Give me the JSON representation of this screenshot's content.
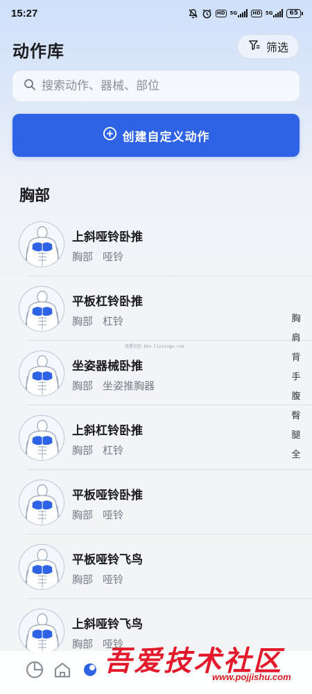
{
  "status_bar": {
    "time": "15:27",
    "network_label_1": "5G",
    "network_label_2": "5G",
    "hd_label": "HD",
    "battery": "65",
    "icons": [
      "mute-bell-icon",
      "alarm-icon",
      "hd-icon",
      "signal-icon",
      "signal-icon",
      "battery-icon"
    ]
  },
  "header": {
    "title": "动作库",
    "filter_label": "筛选"
  },
  "search": {
    "placeholder": "搜索动作、器械、部位"
  },
  "create_button": {
    "label": "创建自定义动作"
  },
  "section": {
    "title": "胸部"
  },
  "exercises": [
    {
      "name": "上斜哑铃卧推",
      "part": "胸部",
      "equipment": "哑铃"
    },
    {
      "name": "平板杠铃卧推",
      "part": "胸部",
      "equipment": "杠铃"
    },
    {
      "name": "坐姿器械卧推",
      "part": "胸部",
      "equipment": "坐姿推胸器"
    },
    {
      "name": "上斜杠铃卧推",
      "part": "胸部",
      "equipment": "杠铃"
    },
    {
      "name": "平板哑铃卧推",
      "part": "胸部",
      "equipment": "哑铃"
    },
    {
      "name": "平板哑铃飞鸟",
      "part": "胸部",
      "equipment": "哑铃"
    },
    {
      "name": "上斜哑铃飞鸟",
      "part": "胸部",
      "equipment": "哑铃"
    }
  ],
  "index_bar": [
    "胸",
    "肩",
    "背",
    "手",
    "腹",
    "臀",
    "腿",
    "全"
  ],
  "watermarks": {
    "small": "流星社区·bbs.liuxingw.com",
    "brand": "吾爱技术社区",
    "url": "www.pojjishu.com"
  },
  "colors": {
    "accent": "#2f63e6",
    "muscle_highlight": "#2f63e6",
    "brand_watermark": "#e21a2b"
  }
}
